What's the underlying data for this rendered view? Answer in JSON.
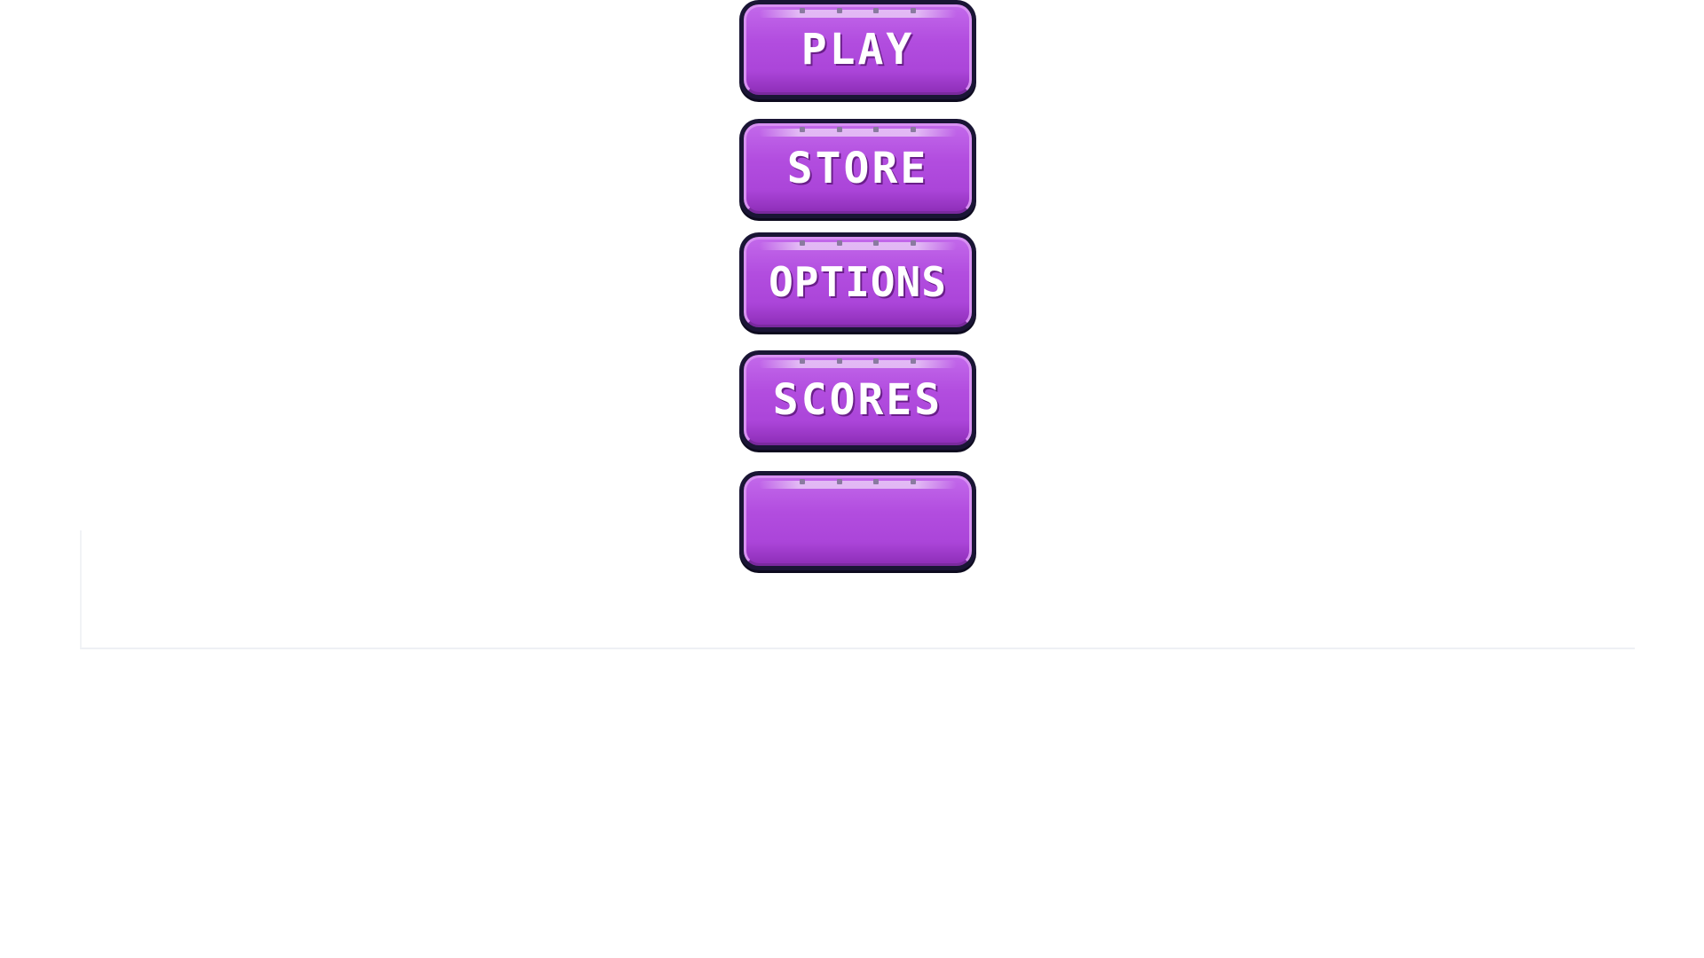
{
  "menu": {
    "buttons": [
      {
        "id": "play",
        "label": "PLAY"
      },
      {
        "id": "store",
        "label": "STORE"
      },
      {
        "id": "options",
        "label": "OPTIONS"
      },
      {
        "id": "scores",
        "label": "SCORES"
      },
      {
        "id": "blank",
        "label": ""
      }
    ]
  },
  "colors": {
    "button_fill": "#b24ddf",
    "button_outline": "#1a1535",
    "label": "#ffffff",
    "background": "#ffffff"
  }
}
